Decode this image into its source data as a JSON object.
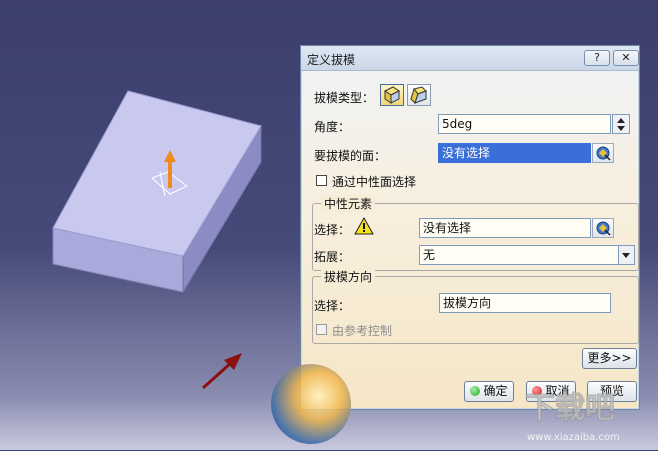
{
  "dialog": {
    "title": "定义拔模",
    "help_label": "?",
    "close_label": "✕",
    "draft_type_label": "拔模类型：",
    "angle_label": "角度：",
    "angle_value": "5deg",
    "faces_label": "要拔模的面：",
    "faces_value": "没有选择",
    "neutral_face_checkbox_label": "通过中性面选择",
    "neutral_group": {
      "title": "中性元素",
      "select_label": "选择：",
      "select_value": "没有选择",
      "propagation_label": "拓展：",
      "propagation_value": "无"
    },
    "direction_group": {
      "title": "拔模方向",
      "select_label": "选择：",
      "select_value": "拔模方向",
      "ref_control_label": "由参考控制"
    },
    "more_button": "更多>>",
    "ok_button": "确定",
    "cancel_button": "取消",
    "preview_button": "预览"
  },
  "watermark": {
    "text": "下载吧",
    "url": "www.xiazaiba.com"
  },
  "colors": {
    "selection": "#3a6fd8",
    "box_top": "#c8c8f0",
    "box_side": "#9b9bd0",
    "arrow_accent": "#f08a1c",
    "ok_dot": "#2aa52a",
    "cancel_dot": "#d22020",
    "pointer_arrow": "#8b1010"
  }
}
